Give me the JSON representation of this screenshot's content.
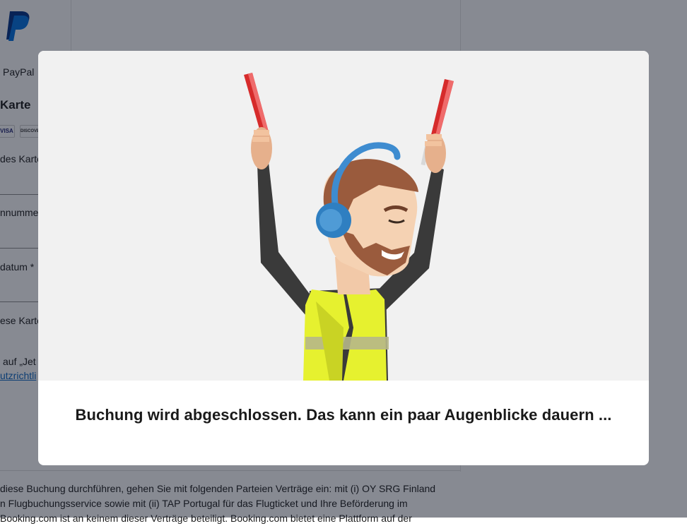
{
  "background": {
    "paypal_option_label": "PayPal",
    "card_section_title": "Karte",
    "card_logos": [
      "VISA",
      "DISCOVER"
    ],
    "fields": [
      {
        "label": "des Karte"
      },
      {
        "label": "nnummer"
      },
      {
        "label": "datum *"
      },
      {
        "label": "ese Karte"
      }
    ],
    "consent_text": "auf „Jet",
    "privacy_link": "utzrichtli",
    "legal_lines": [
      "diese Buchung durchführen, gehen Sie mit folgenden Parteien Verträge ein: mit (i) OY SRG Finland",
      "n Flugbuchungsservice sowie mit (ii) TAP Portugal für das Flugticket und Ihre Beförderung im",
      "Booking.com ist an keinem dieser Verträge beteiligt. Booking.com bietet eine Plattform auf der"
    ]
  },
  "modal": {
    "message": "Buchung wird abgeschlossen. Das kann ein paar Augenblicke dauern ...",
    "illustration": "airport-marshaller-with-headphones"
  },
  "colors": {
    "overlay": "#0f1626",
    "vest": "#e6f12f",
    "paddle": "#d62b2b",
    "headphones": "#2f7fc1"
  }
}
